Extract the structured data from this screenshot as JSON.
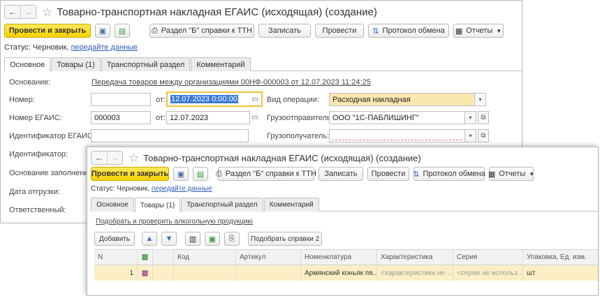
{
  "nav": {
    "back": "←",
    "forward": "→",
    "star": "☆"
  },
  "window1": {
    "title": "Товарно-транспортная накладная ЕГАИС (исходящая) (создание)",
    "toolbar": {
      "post_close": "Провести и закрыть",
      "section_b": "Раздел \"Б\" справки к ТТН",
      "write": "Записать",
      "post": "Провести",
      "protocol": "Протокол обмена",
      "reports": "Отчеты"
    },
    "status_label": "Статус:",
    "status_value": "Черновик,",
    "status_link": "передайте данные",
    "tabs": [
      "Основное",
      "Товары (1)",
      "Транспортный раздел",
      "Комментарий"
    ],
    "form": {
      "basis_label": "Основание:",
      "basis_value": "Передача товаров между организациями 00НФ-000003 от 12.07.2023 11:24:25",
      "number_label": "Номер:",
      "number_value": "",
      "from_label": "от:",
      "date_value": "12.07.2023  0:00:00",
      "op_label": "Вид операции:",
      "op_value": "Расходная накладная",
      "egais_number_label": "Номер ЕГАИС:",
      "egais_number_value": "000003",
      "from2_label": "от:",
      "date2_value": "12.07.2023",
      "shipper_label": "Грузоотправитель:",
      "shipper_value": "ООО \"1С-ПАБЛИШИНГ\"",
      "egais_id_label": "Идентификатор ЕГАИС:",
      "egais_id_value": "",
      "consignee_label": "Грузополучатель:",
      "consignee_value": "",
      "identifier_label": "Идентификатор:",
      "fill_basis_label": "Основание заполнения",
      "ship_date_label": "Дата отгрузки:",
      "responsible_label": "Ответственный:"
    }
  },
  "window2": {
    "title": "Товарно-транспортная накладная ЕГАИС (исходящая) (создание)",
    "toolbar": {
      "post_close": "Провести и закрыть",
      "section_b": "Раздел \"Б\" справки к ТТН",
      "write": "Записать",
      "post": "Провести",
      "protocol": "Протокол обмена",
      "reports": "Отчеты"
    },
    "status_label": "Статус:",
    "status_value": "Черновик,",
    "status_link": "передайте данные",
    "tabs": [
      "Основное",
      "Товары (1)",
      "Транспортный раздел",
      "Комментарий"
    ],
    "pick_link": "Подобрать и проверить алкогольную продукцию",
    "add_button": "Добавить",
    "pick_certs_button": "Подобрать справки 2",
    "table": {
      "headers": [
        "N",
        "",
        "Код",
        "Артикул",
        "Номенклатура",
        "Характеристика",
        "Серия",
        "Упаковка, Ед. изм."
      ],
      "rows": [
        [
          "1",
          "",
          "",
          "",
          "Армянский коньяк пя...",
          "<характеристики не ...",
          "<серии не использ...",
          "шт"
        ]
      ]
    }
  }
}
